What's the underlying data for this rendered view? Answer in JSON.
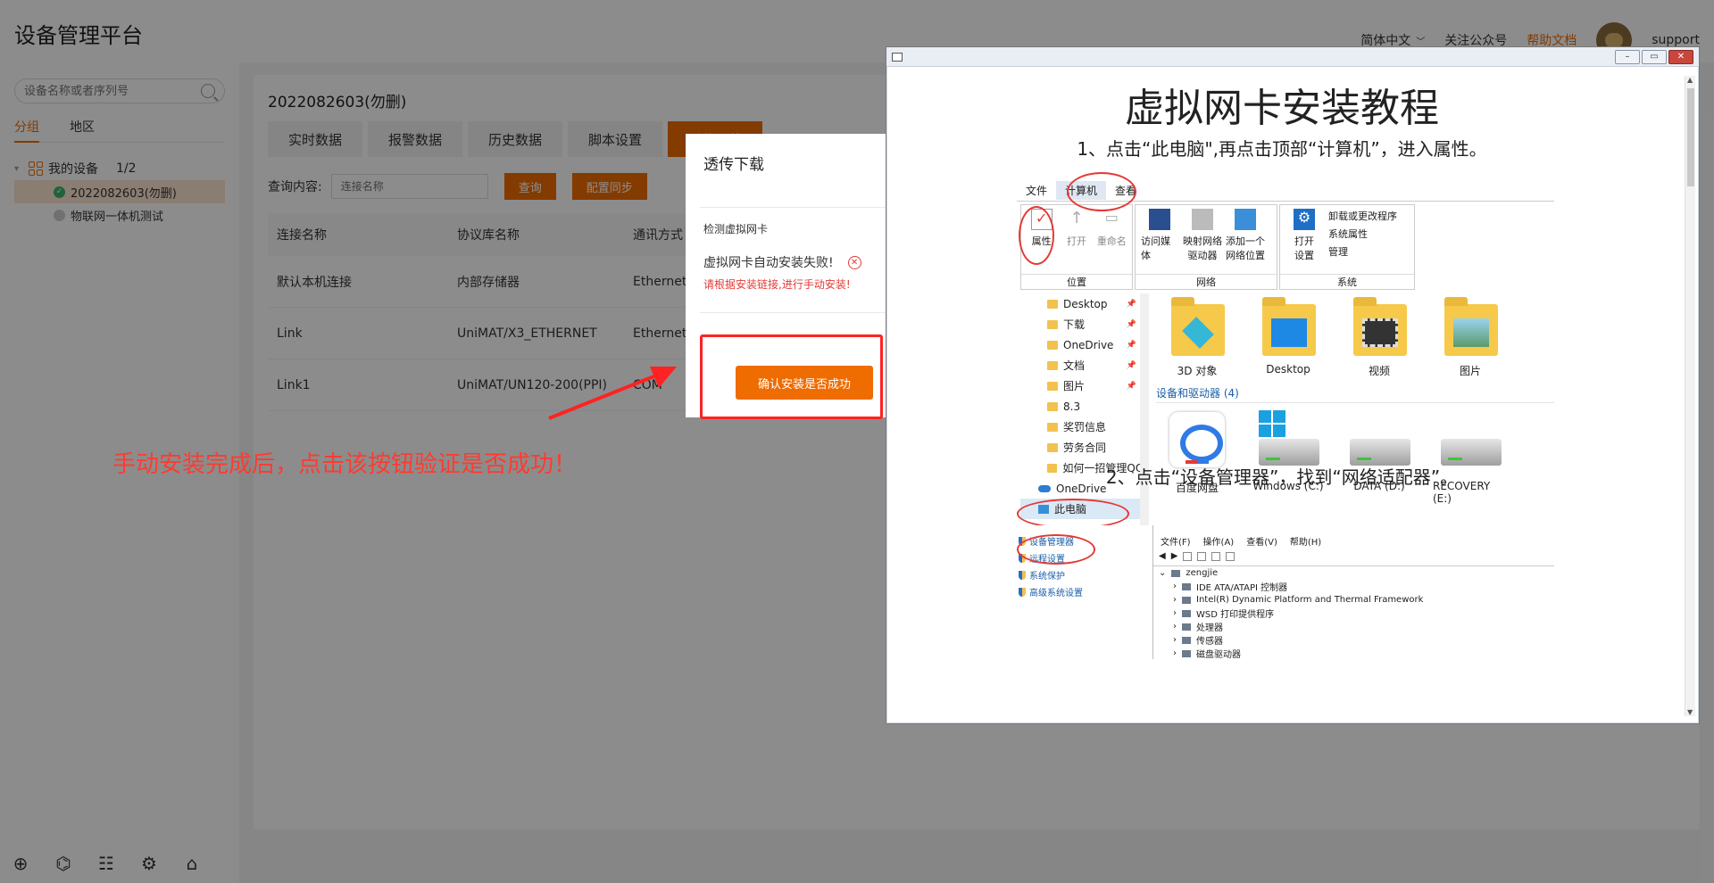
{
  "app": {
    "title": "设备管理平台"
  },
  "topbar": {
    "language": "简体中文",
    "follow": "关注公众号",
    "help": "帮助文档",
    "user": "support"
  },
  "sidebar": {
    "search_placeholder": "设备名称或者序列号",
    "tabs": [
      "分组",
      "地区"
    ],
    "group": {
      "name": "我的设备",
      "count": "1/2"
    },
    "devices": [
      "2022082603(勿删)",
      "物联网一体机测试"
    ]
  },
  "main": {
    "device_title": "2022082603(勿删)",
    "tabs": [
      "实时数据",
      "报警数据",
      "历史数据",
      "脚本设置",
      "透传下载"
    ],
    "query_label": "查询内容:",
    "query_placeholder": "连接名称",
    "query_button": "查询",
    "sync_button": "配置同步",
    "columns": [
      "连接名称",
      "协议库名称",
      "通讯方式"
    ],
    "rows": [
      [
        "默认本机连接",
        "内部存储器",
        "Ethernet"
      ],
      [
        "Link",
        "UniMAT/X3_ETHERNET",
        "Ethernet_"
      ],
      [
        "Link1",
        "UniMAT/UN120-200(PPI)",
        "COM"
      ]
    ]
  },
  "modal": {
    "title": "透传下载",
    "section": "检测虚拟网卡",
    "fail_text": "虚拟网卡自动安装失败!",
    "hint": "请根据安装链接,进行手动安装!",
    "confirm_button": "确认安装是否成功"
  },
  "annotation": "手动安装完成后，点击该按钮验证是否成功！",
  "tutorial": {
    "title": "虚拟网卡安装教程",
    "step1": "1、点击“此电脑\",再点击顶部“计算机”，进入属性。",
    "step2": "2、点击“设备管理器”，找到“网络适配器”。",
    "explorer": {
      "tabs": [
        "文件",
        "计算机",
        "查看"
      ],
      "groups": [
        {
          "label": "位置",
          "items": [
            "属性",
            "打开",
            "重命名"
          ]
        },
        {
          "label": "网络",
          "items": [
            "访问媒体",
            "映射网络驱动器",
            "添加一个网络位置"
          ]
        },
        {
          "label": "系统",
          "items": [
            "打开设置",
            "卸载或更改程序",
            "系统属性",
            "管理"
          ]
        }
      ],
      "nav": [
        "Desktop",
        "下载",
        "OneDrive",
        "文档",
        "图片",
        "8.3",
        "奖罚信息",
        "劳务合同",
        "如何一招管理QQ",
        "OneDrive",
        "此电脑"
      ],
      "folders": [
        "3D 对象",
        "Desktop",
        "视频",
        "图片"
      ],
      "devices_header": "设备和驱动器 (4)",
      "drives": [
        "百度网盘",
        "Windows (C:)",
        "DATA (D:)",
        "RECOVERY (E:)"
      ]
    },
    "device_manager": {
      "left_links": [
        "设备管理器",
        "远程设置",
        "系统保护",
        "高级系统设置"
      ],
      "menu": [
        "文件(F)",
        "操作(A)",
        "查看(V)",
        "帮助(H)"
      ],
      "root": "zengjie",
      "items": [
        "IDE ATA/ATAPI 控制器",
        "Intel(R) Dynamic Platform and Thermal Framework",
        "WSD 打印提供程序",
        "处理器",
        "传感器",
        "磁盘驱动器"
      ]
    }
  },
  "colors": {
    "accent": "#ef6c00",
    "error": "#e53935",
    "annotation": "#ff3b30"
  }
}
